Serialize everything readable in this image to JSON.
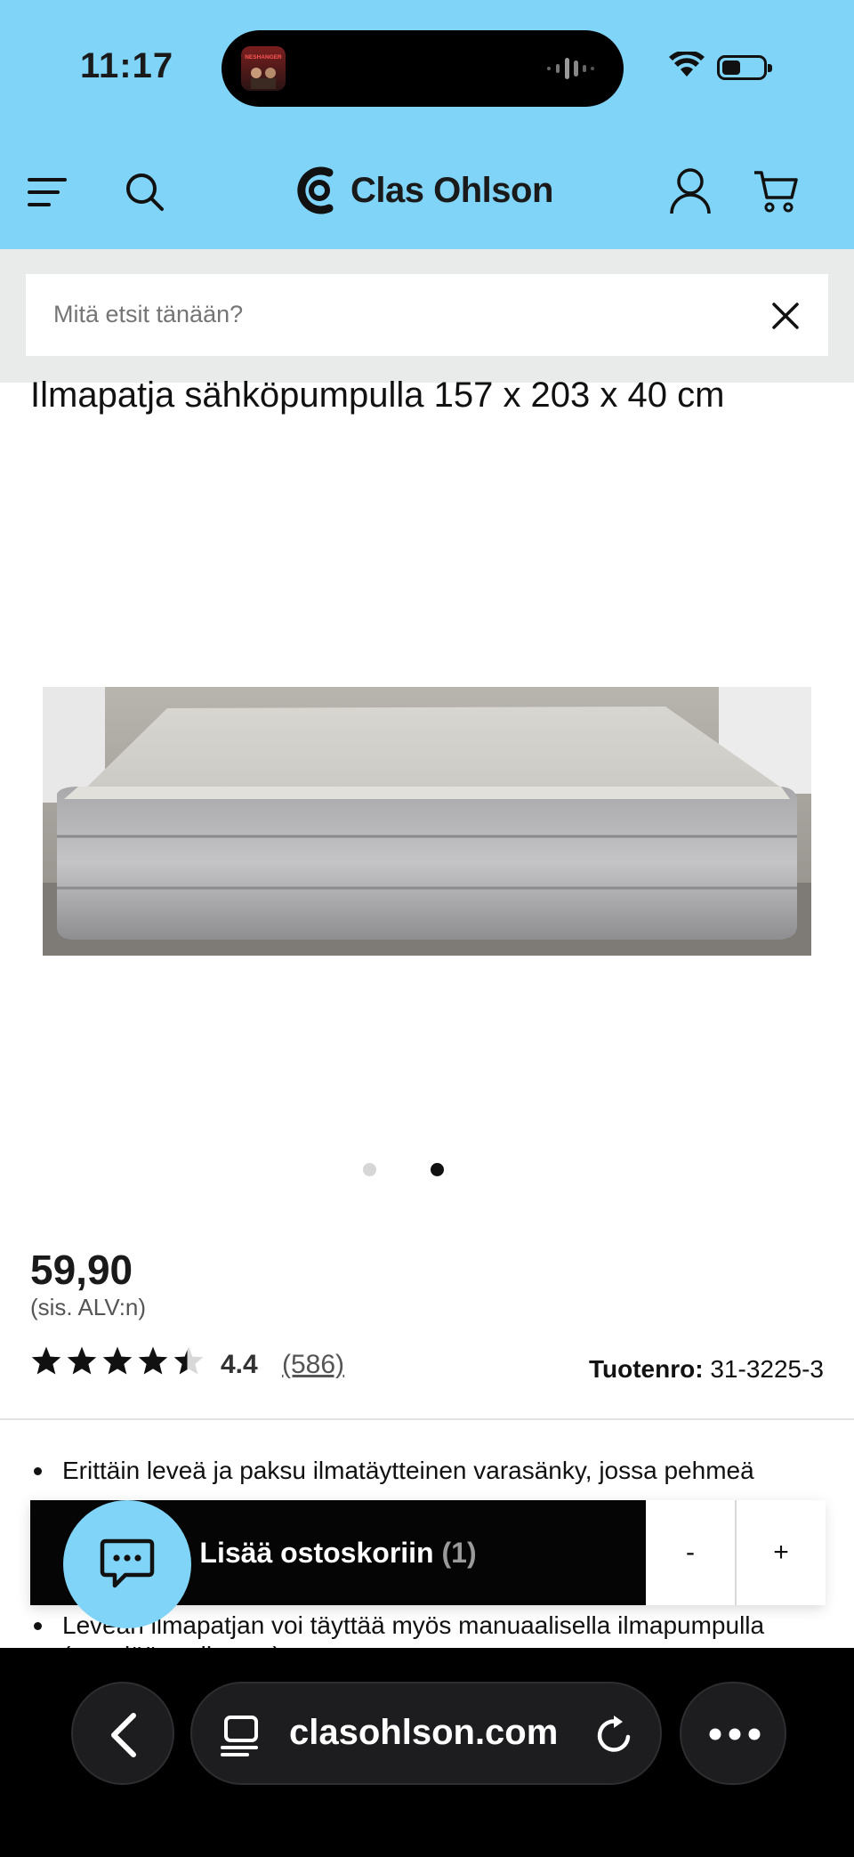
{
  "status_bar": {
    "time": "11:17",
    "media_art_text": "NESHANGER"
  },
  "header": {
    "brand": "Clas Ohlson",
    "colors": {
      "header_bg": "#7fd4f7",
      "cart_button_bg": "#050505"
    },
    "icons": [
      "menu-icon",
      "search-icon",
      "account-icon",
      "cart-icon"
    ]
  },
  "search": {
    "placeholder": "Mitä etsit tänään?"
  },
  "product": {
    "title": "Ilmapatja sähköpumpulla 157 x 203 x 40 cm",
    "image_count": 2,
    "active_image": 2,
    "price": "59,90",
    "vat_note": "(sis. ALV:n)",
    "rating": "4.4",
    "rating_value": 4.4,
    "rating_max": 5,
    "reviews": "(586)",
    "product_no_label": "Tuotenro:",
    "product_no": "31-3225-3",
    "bullets": [
      "Erittäin leveä ja paksu ilmatäytteinen varasänky, jossa pehmeä pukkopinta",
      "Leveän ilmapatjan voi täyttää myös manuaalisella ilmapumpulla (myydään erikseen)"
    ]
  },
  "cart": {
    "add_label": "Lisää ostoskoriin",
    "count": "(1)",
    "minus": "-",
    "plus": "+"
  },
  "browser": {
    "url": "clasohlson.com"
  }
}
